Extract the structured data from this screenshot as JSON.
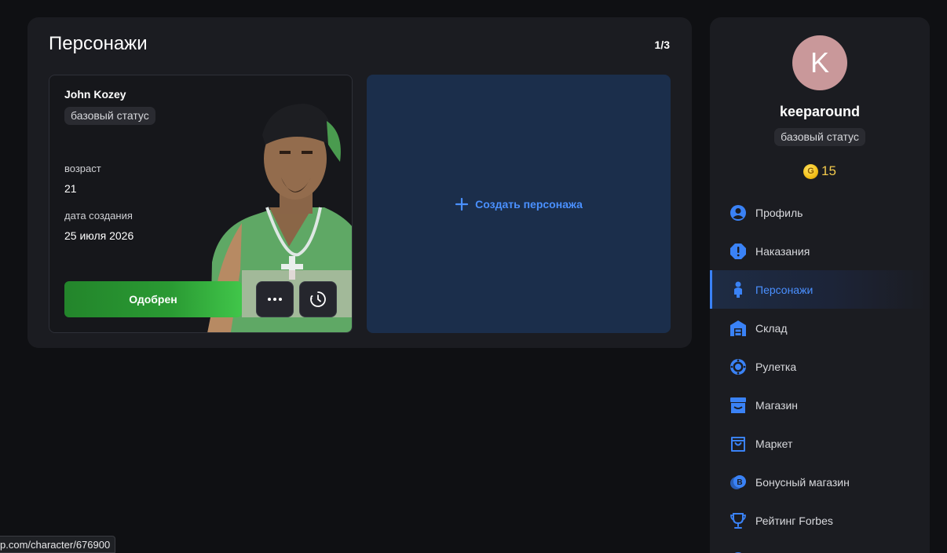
{
  "characters": {
    "title": "Персонажи",
    "count": "1/3",
    "card": {
      "name": "John Kozey",
      "status": "базовый статус",
      "age_label": "возраст",
      "age_value": "21",
      "created_label": "дата создания",
      "created_value": "25 июля 2026",
      "approved_label": "Одобрен"
    },
    "create_label": "Создать персонажа"
  },
  "user": {
    "avatar_letter": "K",
    "username": "keeparound",
    "status": "базовый статус",
    "coin_symbol": "G",
    "balance": "15"
  },
  "nav": {
    "items": [
      {
        "label": "Профиль",
        "icon": "user-circle-icon"
      },
      {
        "label": "Наказания",
        "icon": "alert-hexagon-icon"
      },
      {
        "label": "Персонажи",
        "icon": "person-icon",
        "active": true
      },
      {
        "label": "Склад",
        "icon": "warehouse-icon"
      },
      {
        "label": "Рулетка",
        "icon": "roulette-icon"
      },
      {
        "label": "Магазин",
        "icon": "store-icon"
      },
      {
        "label": "Маркет",
        "icon": "shopping-bag-icon"
      },
      {
        "label": "Бонусный магазин",
        "icon": "bonus-coin-icon"
      },
      {
        "label": "Рейтинг Forbes",
        "icon": "trophy-icon"
      }
    ]
  },
  "status_url": "p.com/character/676900",
  "colors": {
    "accent": "#3a82f6",
    "approved": "#2a9a33",
    "create_bg": "#1b2e4b",
    "coin": "#f2c94c"
  }
}
